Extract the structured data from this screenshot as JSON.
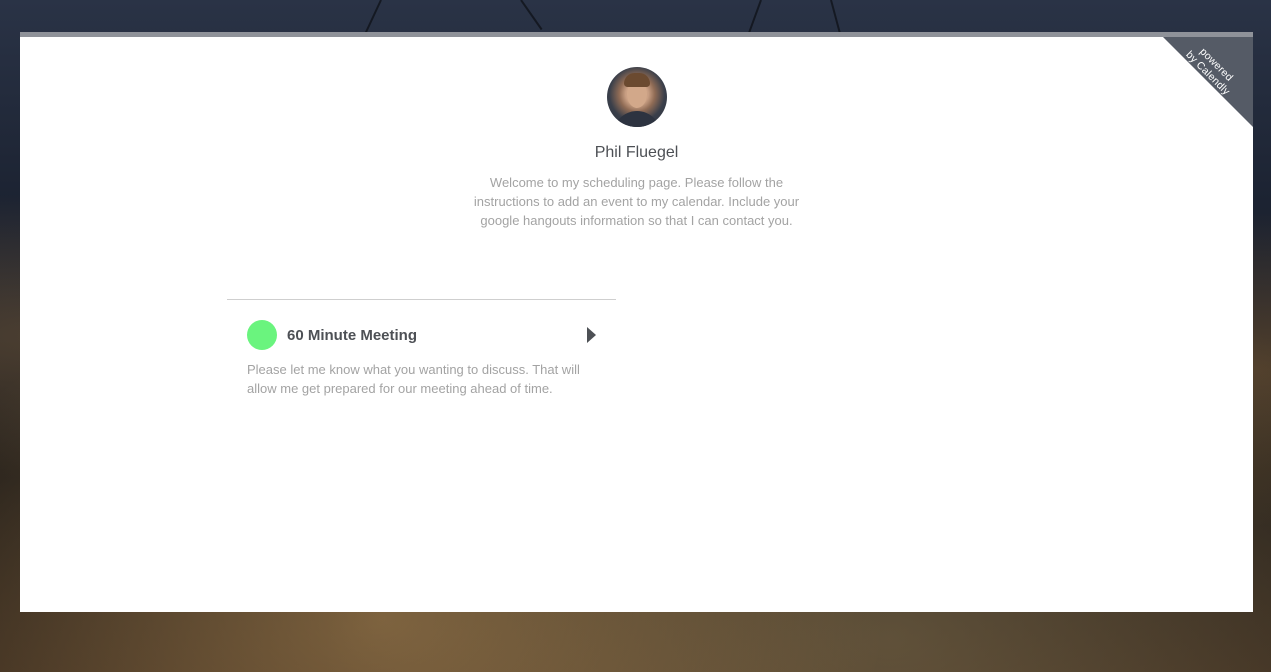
{
  "ribbon": {
    "line1": "powered",
    "line2": "by Calendly"
  },
  "profile": {
    "name": "Phil Fluegel",
    "welcome": "Welcome to my scheduling page. Please follow the instructions to add an event to my calendar. Include your google hangouts information so that I can contact you."
  },
  "events": [
    {
      "title": "60 Minute Meeting",
      "description": "Please let me know what you wanting to discuss. That will allow me get prepared for our meeting ahead of time.",
      "color": "#6af47e",
      "icon": "chevron-right-icon"
    }
  ],
  "colors": {
    "ribbon": "#555b66",
    "text_dark": "#4d5055",
    "text_muted": "#a3a3a3"
  }
}
